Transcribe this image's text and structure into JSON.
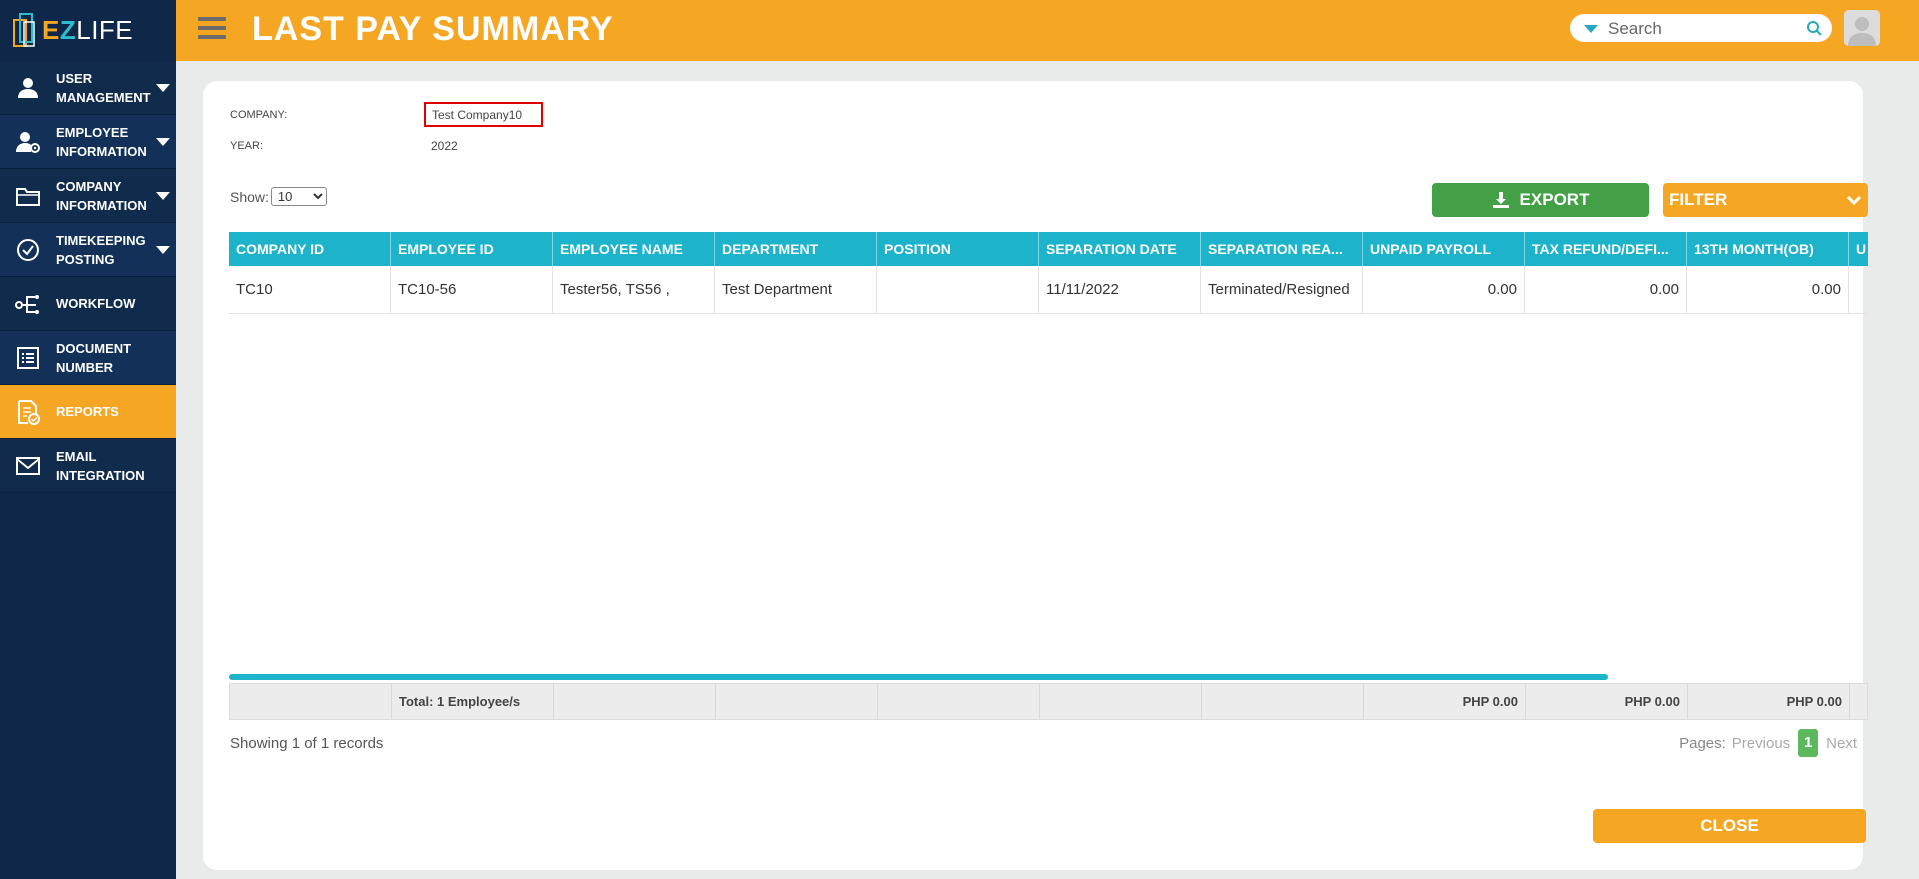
{
  "app": {
    "logo_text_e": "E",
    "logo_text_z": "Z",
    "logo_text_rest": "LIFE"
  },
  "sidebar": {
    "items": [
      {
        "label": "USER MANAGEMENT",
        "icon": "user-icon",
        "has_caret": true
      },
      {
        "label": "EMPLOYEE INFORMATION",
        "icon": "employee-gear-icon",
        "has_caret": true
      },
      {
        "label": "COMPANY INFORMATION",
        "icon": "folder-icon",
        "has_caret": true
      },
      {
        "label": "TIMEKEEPING POSTING",
        "icon": "check-circle-icon",
        "has_caret": true
      },
      {
        "label": "WORKFLOW",
        "icon": "workflow-icon",
        "has_caret": false
      },
      {
        "label": "DOCUMENT NUMBER",
        "icon": "list-icon",
        "has_caret": false
      },
      {
        "label": "REPORTS",
        "icon": "report-check-icon",
        "has_caret": false,
        "active": true
      },
      {
        "label": "EMAIL INTEGRATION",
        "icon": "mail-icon",
        "has_caret": false
      }
    ]
  },
  "header": {
    "title": "LAST PAY SUMMARY",
    "search_placeholder": "Search"
  },
  "meta": {
    "company_label": "COMPANY:",
    "company_value": "Test Company10",
    "year_label": "YEAR:",
    "year_value": "2022"
  },
  "controls": {
    "show_label": "Show:",
    "show_value": "10",
    "export_label": "EXPORT",
    "filter_label": "FILTER"
  },
  "table": {
    "columns": [
      "COMPANY ID",
      "EMPLOYEE ID",
      "EMPLOYEE NAME",
      "DEPARTMENT",
      "POSITION",
      "SEPARATION DATE",
      "SEPARATION REA...",
      "UNPAID PAYROLL",
      "TAX REFUND/DEFI...",
      "13TH MONTH(OB)",
      "U"
    ],
    "rows": [
      [
        "TC10",
        "TC10-56",
        "Tester56, TS56 ,",
        "Test Department",
        "",
        "11/11/2022",
        "Terminated/Resigned",
        "0.00",
        "0.00",
        "0.00",
        ""
      ]
    ],
    "footer": [
      "",
      "Total: 1 Employee/s",
      "",
      "",
      "",
      "",
      "",
      "PHP 0.00",
      "PHP 0.00",
      "PHP 0.00",
      ""
    ]
  },
  "pagination": {
    "records_text": "Showing 1 of 1 records",
    "pages_label": "Pages:",
    "previous_label": "Previous",
    "current_page": "1",
    "next_label": "Next"
  },
  "actions": {
    "close_label": "CLOSE"
  },
  "colors": {
    "accent_orange": "#f5a623",
    "sidebar_navy": "#0f2849",
    "table_header_teal": "#1cb3cb",
    "export_green": "#43a046"
  }
}
